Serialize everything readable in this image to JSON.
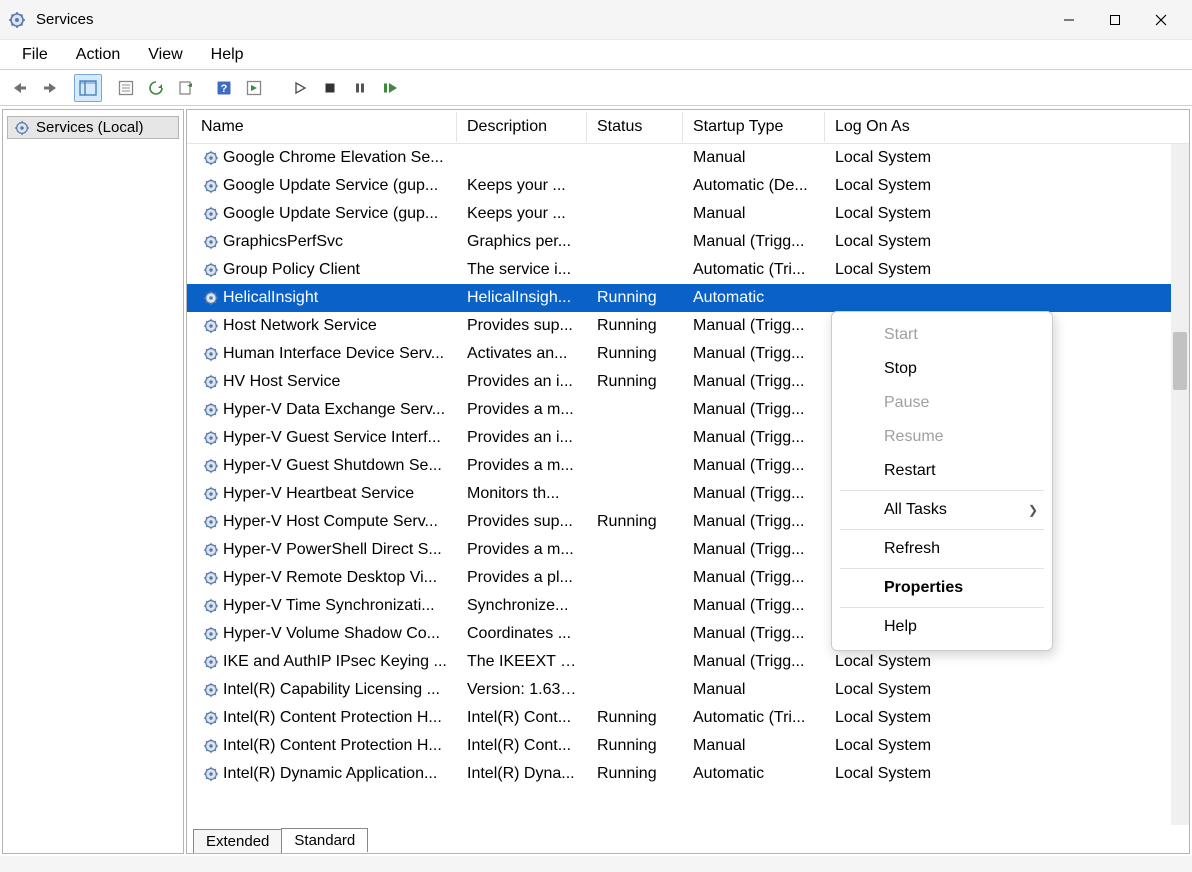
{
  "window": {
    "title": "Services"
  },
  "menubar": [
    "File",
    "Action",
    "View",
    "Help"
  ],
  "left_pane": {
    "label": "Services (Local)"
  },
  "columns": {
    "name": "Name",
    "description": "Description",
    "status": "Status",
    "startup": "Startup Type",
    "logon": "Log On As"
  },
  "rows": [
    {
      "name": "Google Chrome Elevation Se...",
      "desc": "",
      "status": "",
      "startup": "Manual",
      "logon": "Local System",
      "selected": false
    },
    {
      "name": "Google Update Service (gup...",
      "desc": "Keeps your ...",
      "status": "",
      "startup": "Automatic (De...",
      "logon": "Local System",
      "selected": false
    },
    {
      "name": "Google Update Service (gup...",
      "desc": "Keeps your ...",
      "status": "",
      "startup": "Manual",
      "logon": "Local System",
      "selected": false
    },
    {
      "name": "GraphicsPerfSvc",
      "desc": "Graphics per...",
      "status": "",
      "startup": "Manual (Trigg...",
      "logon": "Local System",
      "selected": false
    },
    {
      "name": "Group Policy Client",
      "desc": "The service i...",
      "status": "",
      "startup": "Automatic (Tri...",
      "logon": "Local System",
      "selected": false
    },
    {
      "name": "HelicalInsight",
      "desc": "HelicalInsigh...",
      "status": "Running",
      "startup": "Automatic",
      "logon": "",
      "selected": true
    },
    {
      "name": "Host Network Service",
      "desc": "Provides sup...",
      "status": "Running",
      "startup": "Manual (Trigg...",
      "logon": "",
      "selected": false
    },
    {
      "name": "Human Interface Device Serv...",
      "desc": "Activates an...",
      "status": "Running",
      "startup": "Manual (Trigg...",
      "logon": "",
      "selected": false
    },
    {
      "name": "HV Host Service",
      "desc": "Provides an i...",
      "status": "Running",
      "startup": "Manual (Trigg...",
      "logon": "",
      "selected": false
    },
    {
      "name": "Hyper-V Data Exchange Serv...",
      "desc": "Provides a m...",
      "status": "",
      "startup": "Manual (Trigg...",
      "logon": "",
      "selected": false
    },
    {
      "name": "Hyper-V Guest Service Interf...",
      "desc": "Provides an i...",
      "status": "",
      "startup": "Manual (Trigg...",
      "logon": "",
      "selected": false
    },
    {
      "name": "Hyper-V Guest Shutdown Se...",
      "desc": "Provides a m...",
      "status": "",
      "startup": "Manual (Trigg...",
      "logon": "",
      "selected": false
    },
    {
      "name": "Hyper-V Heartbeat Service",
      "desc": "Monitors th...",
      "status": "",
      "startup": "Manual (Trigg...",
      "logon": "",
      "selected": false
    },
    {
      "name": "Hyper-V Host Compute Serv...",
      "desc": "Provides sup...",
      "status": "Running",
      "startup": "Manual (Trigg...",
      "logon": "",
      "selected": false
    },
    {
      "name": "Hyper-V PowerShell Direct S...",
      "desc": "Provides a m...",
      "status": "",
      "startup": "Manual (Trigg...",
      "logon": "",
      "selected": false
    },
    {
      "name": "Hyper-V Remote Desktop Vi...",
      "desc": "Provides a pl...",
      "status": "",
      "startup": "Manual (Trigg...",
      "logon": "",
      "selected": false
    },
    {
      "name": "Hyper-V Time Synchronizati...",
      "desc": "Synchronize...",
      "status": "",
      "startup": "Manual (Trigg...",
      "logon": "",
      "selected": false
    },
    {
      "name": "Hyper-V Volume Shadow Co...",
      "desc": "Coordinates ...",
      "status": "",
      "startup": "Manual (Trigg...",
      "logon": "",
      "selected": false
    },
    {
      "name": "IKE and AuthIP IPsec Keying ...",
      "desc": "The IKEEXT s...",
      "status": "",
      "startup": "Manual (Trigg...",
      "logon": "Local System",
      "selected": false
    },
    {
      "name": "Intel(R) Capability Licensing ...",
      "desc": "Version: 1.63....",
      "status": "",
      "startup": "Manual",
      "logon": "Local System",
      "selected": false
    },
    {
      "name": "Intel(R) Content Protection H...",
      "desc": "Intel(R) Cont...",
      "status": "Running",
      "startup": "Automatic (Tri...",
      "logon": "Local System",
      "selected": false
    },
    {
      "name": "Intel(R) Content Protection H...",
      "desc": "Intel(R) Cont...",
      "status": "Running",
      "startup": "Manual",
      "logon": "Local System",
      "selected": false
    },
    {
      "name": "Intel(R) Dynamic Application...",
      "desc": "Intel(R) Dyna...",
      "status": "Running",
      "startup": "Automatic",
      "logon": "Local System",
      "selected": false
    }
  ],
  "tabs": {
    "extended": "Extended",
    "standard": "Standard"
  },
  "context_menu": {
    "start": "Start",
    "stop": "Stop",
    "pause": "Pause",
    "resume": "Resume",
    "restart": "Restart",
    "all_tasks": "All Tasks",
    "refresh": "Refresh",
    "properties": "Properties",
    "help": "Help"
  }
}
